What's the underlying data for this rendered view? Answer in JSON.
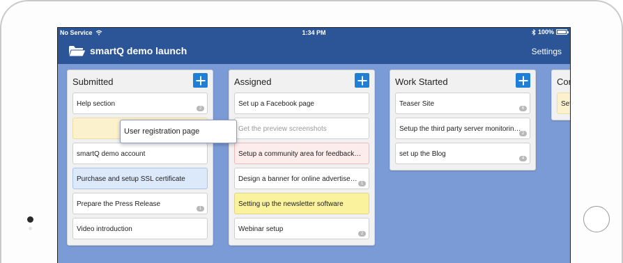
{
  "status_bar": {
    "carrier": "No Service",
    "time": "1:34 PM",
    "battery": "100%"
  },
  "nav": {
    "title": "smartQ demo launch",
    "settings": "Settings"
  },
  "columns": [
    {
      "title": "Submitted",
      "cards": [
        {
          "text": "Help section",
          "badge": "2"
        },
        {
          "text": "",
          "badge": "2"
        },
        {
          "text": "smartQ demo account",
          "badge": ""
        },
        {
          "text": "Purchase and setup SSL certificate",
          "badge": ""
        },
        {
          "text": "Prepare the Press Release",
          "badge": "1"
        },
        {
          "text": "Video introduction",
          "badge": ""
        }
      ]
    },
    {
      "title": "Assigned",
      "cards": [
        {
          "text": "Set up a Facebook page",
          "badge": ""
        },
        {
          "text": "Get the preview screenshots",
          "badge": ""
        },
        {
          "text": "Setup a community area for feedback…",
          "badge": ""
        },
        {
          "text": "Design a banner for online advertise…",
          "badge": "1"
        },
        {
          "text": "Setting up the newsletter software",
          "badge": ""
        },
        {
          "text": "Webinar setup",
          "badge": "2"
        }
      ]
    },
    {
      "title": "Work Started",
      "cards": [
        {
          "text": "Teaser Site",
          "badge": "6"
        },
        {
          "text": "Setup the third party server monitorin…",
          "badge": "2"
        },
        {
          "text": "set up the Blog",
          "badge": "4"
        }
      ]
    },
    {
      "title": "Con",
      "cards": [
        {
          "text": "Set",
          "badge": ""
        }
      ]
    }
  ],
  "dragging_card": {
    "text": "User registration page"
  },
  "colors": {
    "nav_bg": "#2b5596",
    "board_bg": "#7b9bd7",
    "add_button": "#1f7fd6",
    "card_yellow": "#fbf29e",
    "card_blue": "#dbe9fb",
    "card_red": "#fdecec"
  }
}
